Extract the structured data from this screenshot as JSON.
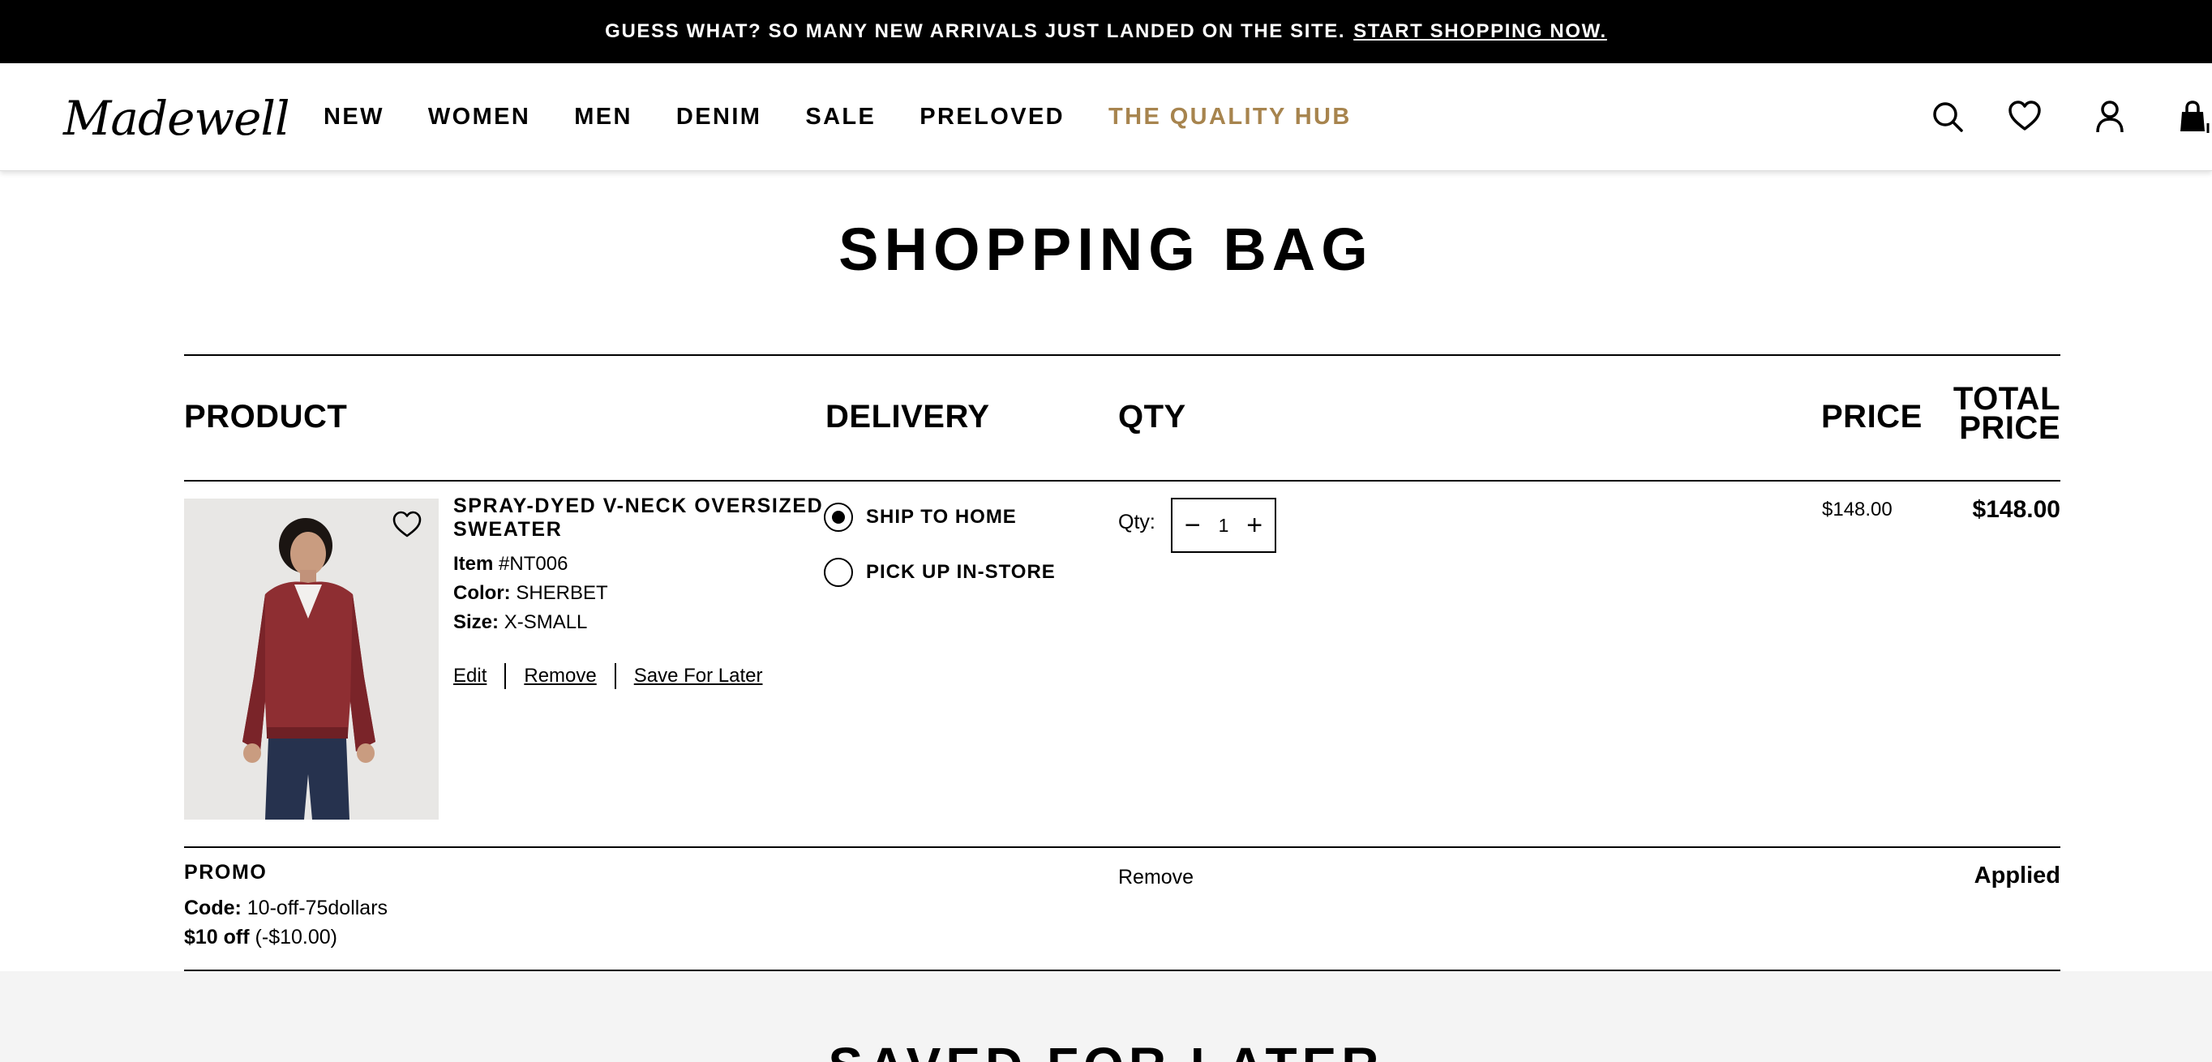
{
  "promo_bar": {
    "text": "GUESS WHAT? SO MANY NEW ARRIVALS JUST LANDED ON THE SITE.",
    "link": "START SHOPPING NOW."
  },
  "nav": {
    "logo": "Madewell",
    "links": [
      "NEW",
      "WOMEN",
      "MEN",
      "DENIM",
      "SALE",
      "PRELOVED",
      "THE QUALITY HUB"
    ],
    "accent_color": "#a7844e",
    "icons": [
      "search-icon",
      "heart-icon",
      "account-icon",
      "bag-icon"
    ]
  },
  "page": {
    "title": "SHOPPING BAG"
  },
  "table": {
    "headers": {
      "product": "PRODUCT",
      "delivery": "DELIVERY",
      "qty": "QTY",
      "price": "PRICE",
      "total_line1": "TOTAL",
      "total_line2": "PRICE"
    }
  },
  "item": {
    "name": "SPRAY-DYED V-NECK OVERSIZED SWEATER",
    "item_label": "Item",
    "item_number": "#NT006",
    "color_label": "Color:",
    "color": "SHERBET",
    "size_label": "Size:",
    "size": "X-SMALL",
    "actions": {
      "edit": "Edit",
      "remove": "Remove",
      "save_for_later": "Save For Later"
    },
    "delivery_options": [
      {
        "label": "SHIP TO HOME",
        "selected": true
      },
      {
        "label": "PICK UP IN-STORE",
        "selected": false
      }
    ],
    "qty_label": "Qty:",
    "qty": "1",
    "price": "$148.00",
    "total": "$148.00"
  },
  "promo": {
    "title": "PROMO",
    "code_label": "Code:",
    "code": "10-off-75dollars",
    "discount_label": "$10 off",
    "discount_amount": "(-$10.00)",
    "remove": "Remove",
    "status": "Applied"
  },
  "saved": {
    "title": "SAVED FOR LATER"
  }
}
